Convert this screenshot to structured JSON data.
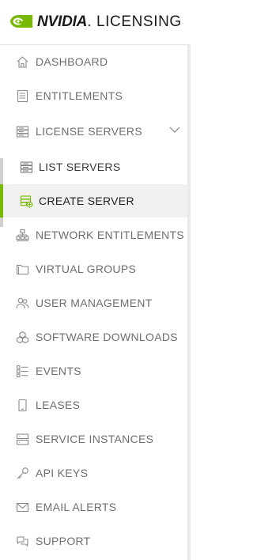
{
  "brand": {
    "name_bold": "NVIDIA",
    "name_rest": ". LICENSING",
    "accent": "#76b900"
  },
  "nav": {
    "items": [
      {
        "label": "DASHBOARD",
        "icon": "home-icon"
      },
      {
        "label": "ENTITLEMENTS",
        "icon": "list-doc-icon"
      },
      {
        "label": "LICENSE SERVERS",
        "icon": "server-stack-icon",
        "expanded": true
      },
      {
        "label": "LIST SERVERS",
        "icon": "server-list-icon"
      },
      {
        "label": "CREATE SERVER",
        "icon": "create-server-icon",
        "active": true
      },
      {
        "label": "NETWORK ENTITLEMENTS",
        "icon": "network-icon"
      },
      {
        "label": "VIRTUAL GROUPS",
        "icon": "folder-icon"
      },
      {
        "label": "USER MANAGEMENT",
        "icon": "users-icon"
      },
      {
        "label": "SOFTWARE DOWNLOADS",
        "icon": "cubes-icon"
      },
      {
        "label": "EVENTS",
        "icon": "events-list-icon"
      },
      {
        "label": "LEASES",
        "icon": "phone-icon"
      },
      {
        "label": "SERVICE INSTANCES",
        "icon": "instances-icon"
      },
      {
        "label": "API KEYS",
        "icon": "key-icon"
      },
      {
        "label": "EMAIL ALERTS",
        "icon": "envelope-icon"
      },
      {
        "label": "SUPPORT",
        "icon": "chat-icon"
      }
    ]
  }
}
